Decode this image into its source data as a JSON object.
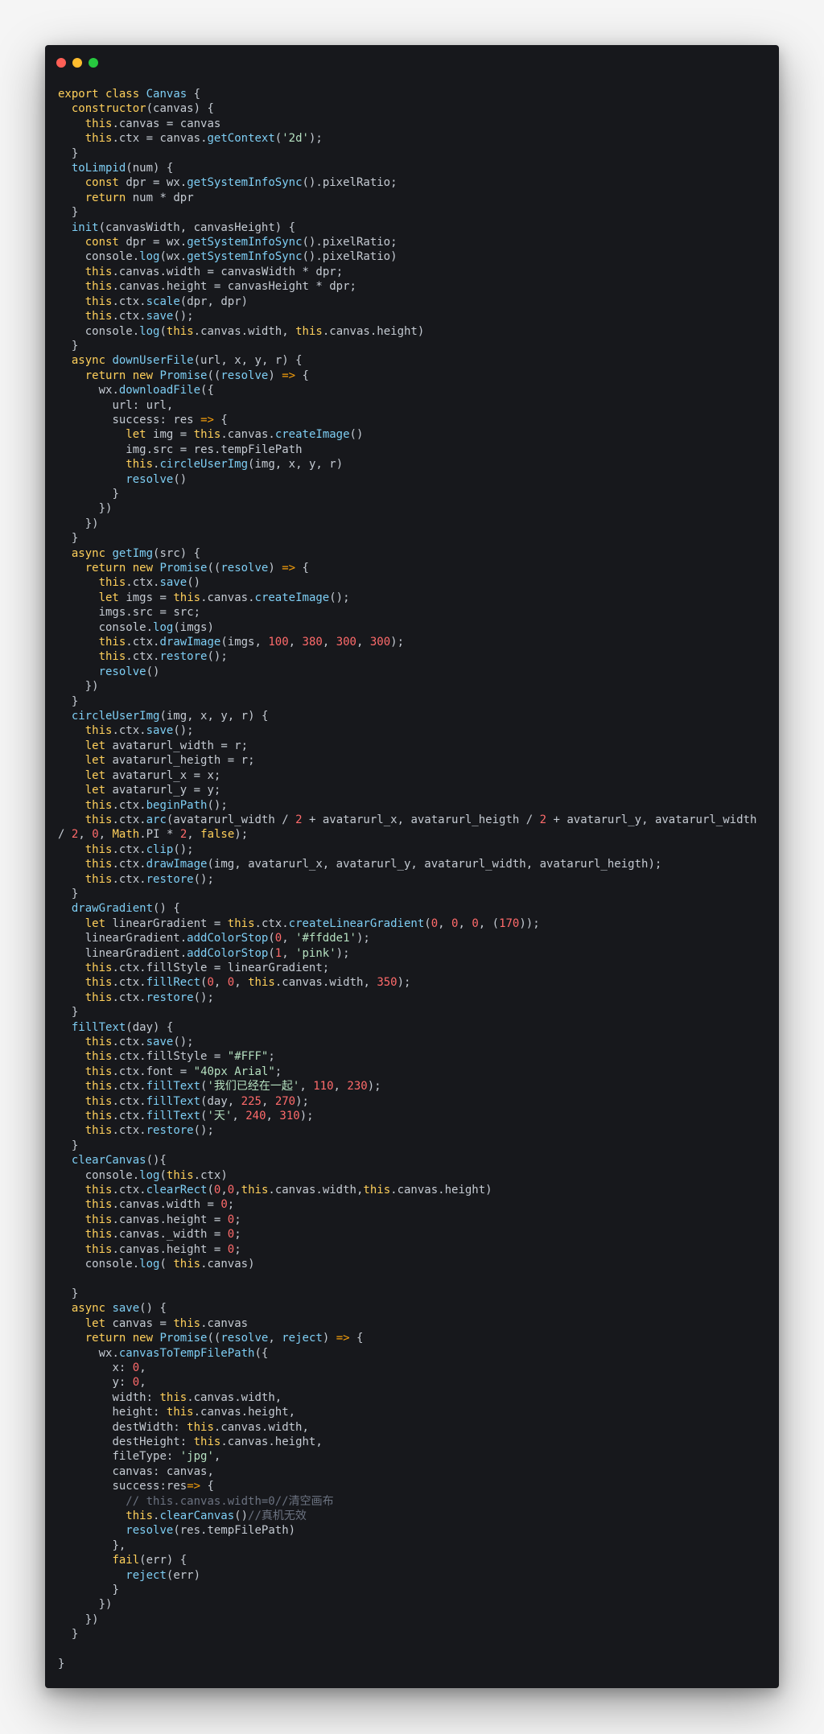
{
  "window": {
    "traffic_lights": {
      "close_color": "#ff5f56",
      "minimize_color": "#ffbd2e",
      "maximize_color": "#27c93f"
    }
  },
  "colors": {
    "background": "#f5f5f5",
    "window": "#17181c",
    "keyword": "#ffd05b",
    "function": "#7ecef4",
    "string": "#b5e0c0",
    "number": "#ff6b6b",
    "comment": "#6b7280",
    "operator": "#f59e0b",
    "plain": "#c5cbd3"
  },
  "code_lines": [
    "export class Canvas {",
    "  constructor(canvas) {",
    "    this.canvas = canvas",
    "    this.ctx = canvas.getContext('2d');",
    "  }",
    "  toLimpid(num) {",
    "    const dpr = wx.getSystemInfoSync().pixelRatio;",
    "    return num * dpr",
    "  }",
    "  init(canvasWidth, canvasHeight) {",
    "    const dpr = wx.getSystemInfoSync().pixelRatio;",
    "    console.log(wx.getSystemInfoSync().pixelRatio)",
    "    this.canvas.width = canvasWidth * dpr;",
    "    this.canvas.height = canvasHeight * dpr;",
    "    this.ctx.scale(dpr, dpr)",
    "    this.ctx.save();",
    "    console.log(this.canvas.width, this.canvas.height)",
    "  }",
    "  async downUserFile(url, x, y, r) {",
    "    return new Promise((resolve) => {",
    "      wx.downloadFile({",
    "        url: url,",
    "        success: res => {",
    "          let img = this.canvas.createImage()",
    "          img.src = res.tempFilePath",
    "          this.circleUserImg(img, x, y, r)",
    "          resolve()",
    "        }",
    "      })",
    "    })",
    "  }",
    "  async getImg(src) {",
    "    return new Promise((resolve) => {",
    "      this.ctx.save()",
    "      let imgs = this.canvas.createImage();",
    "      imgs.src = src;",
    "      console.log(imgs)",
    "      this.ctx.drawImage(imgs, 100, 380, 300, 300);",
    "      this.ctx.restore();",
    "      resolve()",
    "    })",
    "  }",
    "  circleUserImg(img, x, y, r) {",
    "    this.ctx.save();",
    "    let avatarurl_width = r;",
    "    let avatarurl_heigth = r;",
    "    let avatarurl_x = x;",
    "    let avatarurl_y = y;",
    "    this.ctx.beginPath();",
    "    this.ctx.arc(avatarurl_width / 2 + avatarurl_x, avatarurl_heigth / 2 + avatarurl_y, avatarurl_width / 2, 0, Math.PI * 2, false);",
    "    this.ctx.clip();",
    "    this.ctx.drawImage(img, avatarurl_x, avatarurl_y, avatarurl_width, avatarurl_heigth);",
    "    this.ctx.restore();",
    "  }",
    "  drawGradient() {",
    "    let linearGradient = this.ctx.createLinearGradient(0, 0, 0, (170));",
    "    linearGradient.addColorStop(0, '#ffdde1');",
    "    linearGradient.addColorStop(1, 'pink');",
    "    this.ctx.fillStyle = linearGradient;",
    "    this.ctx.fillRect(0, 0, this.canvas.width, 350);",
    "    this.ctx.restore();",
    "  }",
    "  fillText(day) {",
    "    this.ctx.save();",
    "    this.ctx.fillStyle = \"#FFF\";",
    "    this.ctx.font = \"40px Arial\";",
    "    this.ctx.fillText('我们已经在一起', 110, 230);",
    "    this.ctx.fillText(day, 225, 270);",
    "    this.ctx.fillText('天', 240, 310);",
    "    this.ctx.restore();",
    "  }",
    "  clearCanvas(){",
    "    console.log(this.ctx)",
    "    this.ctx.clearRect(0,0,this.canvas.width,this.canvas.height)",
    "    this.canvas.width = 0;",
    "    this.canvas.height = 0;",
    "    this.canvas._width = 0;",
    "    this.canvas.height = 0;",
    "    console.log( this.canvas)",
    "",
    "  }",
    "  async save() {",
    "    let canvas = this.canvas",
    "    return new Promise((resolve, reject) => {",
    "      wx.canvasToTempFilePath({",
    "        x: 0,",
    "        y: 0,",
    "        width: this.canvas.width,",
    "        height: this.canvas.height,",
    "        destWidth: this.canvas.width,",
    "        destHeight: this.canvas.height,",
    "        fileType: 'jpg',",
    "        canvas: canvas,",
    "        success:res=> {",
    "          // this.canvas.width=0//清空画布",
    "          this.clearCanvas()//真机无效",
    "          resolve(res.tempFilePath)",
    "        },",
    "        fail(err) {",
    "          reject(err)",
    "        }",
    "      })",
    "    })",
    "  }",
    "",
    "}"
  ]
}
